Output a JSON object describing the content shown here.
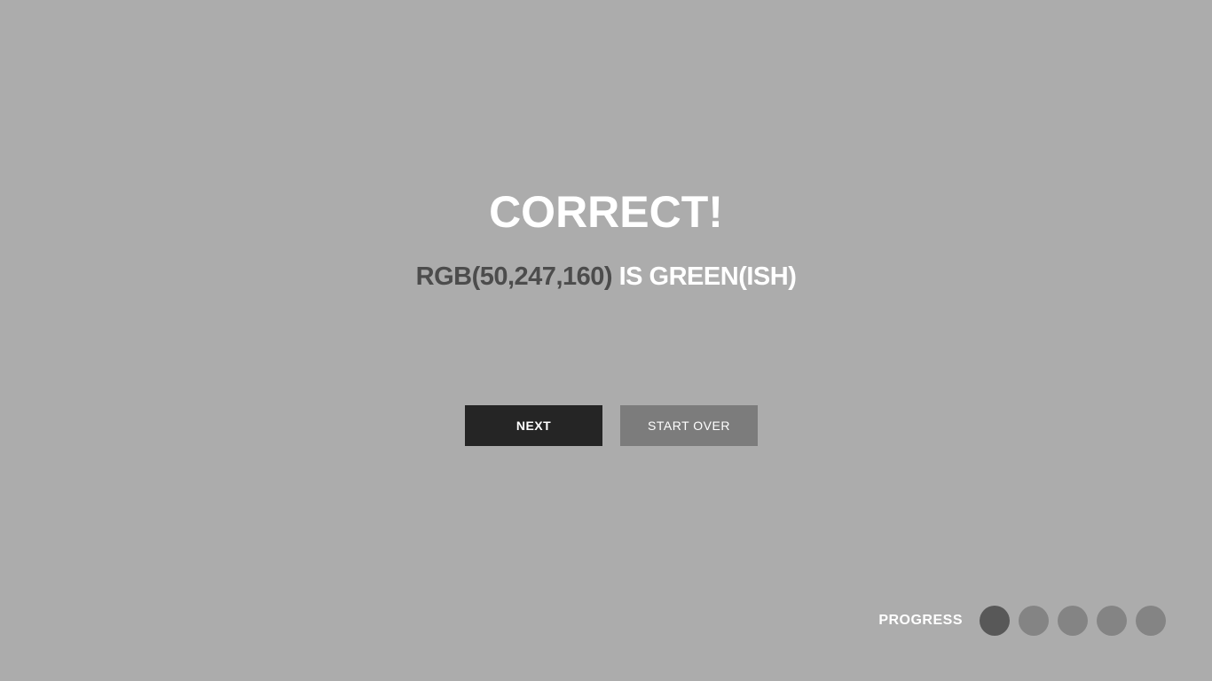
{
  "result": {
    "title": "CORRECT!",
    "rgb_text": "RGB(50,247,160)",
    "answer_text": " IS GREEN(ISH)"
  },
  "buttons": {
    "next_label": "NEXT",
    "start_over_label": "START OVER"
  },
  "progress": {
    "label": "PROGRESS",
    "total_steps": 5,
    "completed_steps": 1
  },
  "colors": {
    "background": "#acacac",
    "title": "#ffffff",
    "rgb_value": "#4c4c4c",
    "next_button": "#252525",
    "start_over_button": "#7c7c7c",
    "progress_dot_active": "#585858",
    "progress_dot_inactive": "#848484"
  }
}
